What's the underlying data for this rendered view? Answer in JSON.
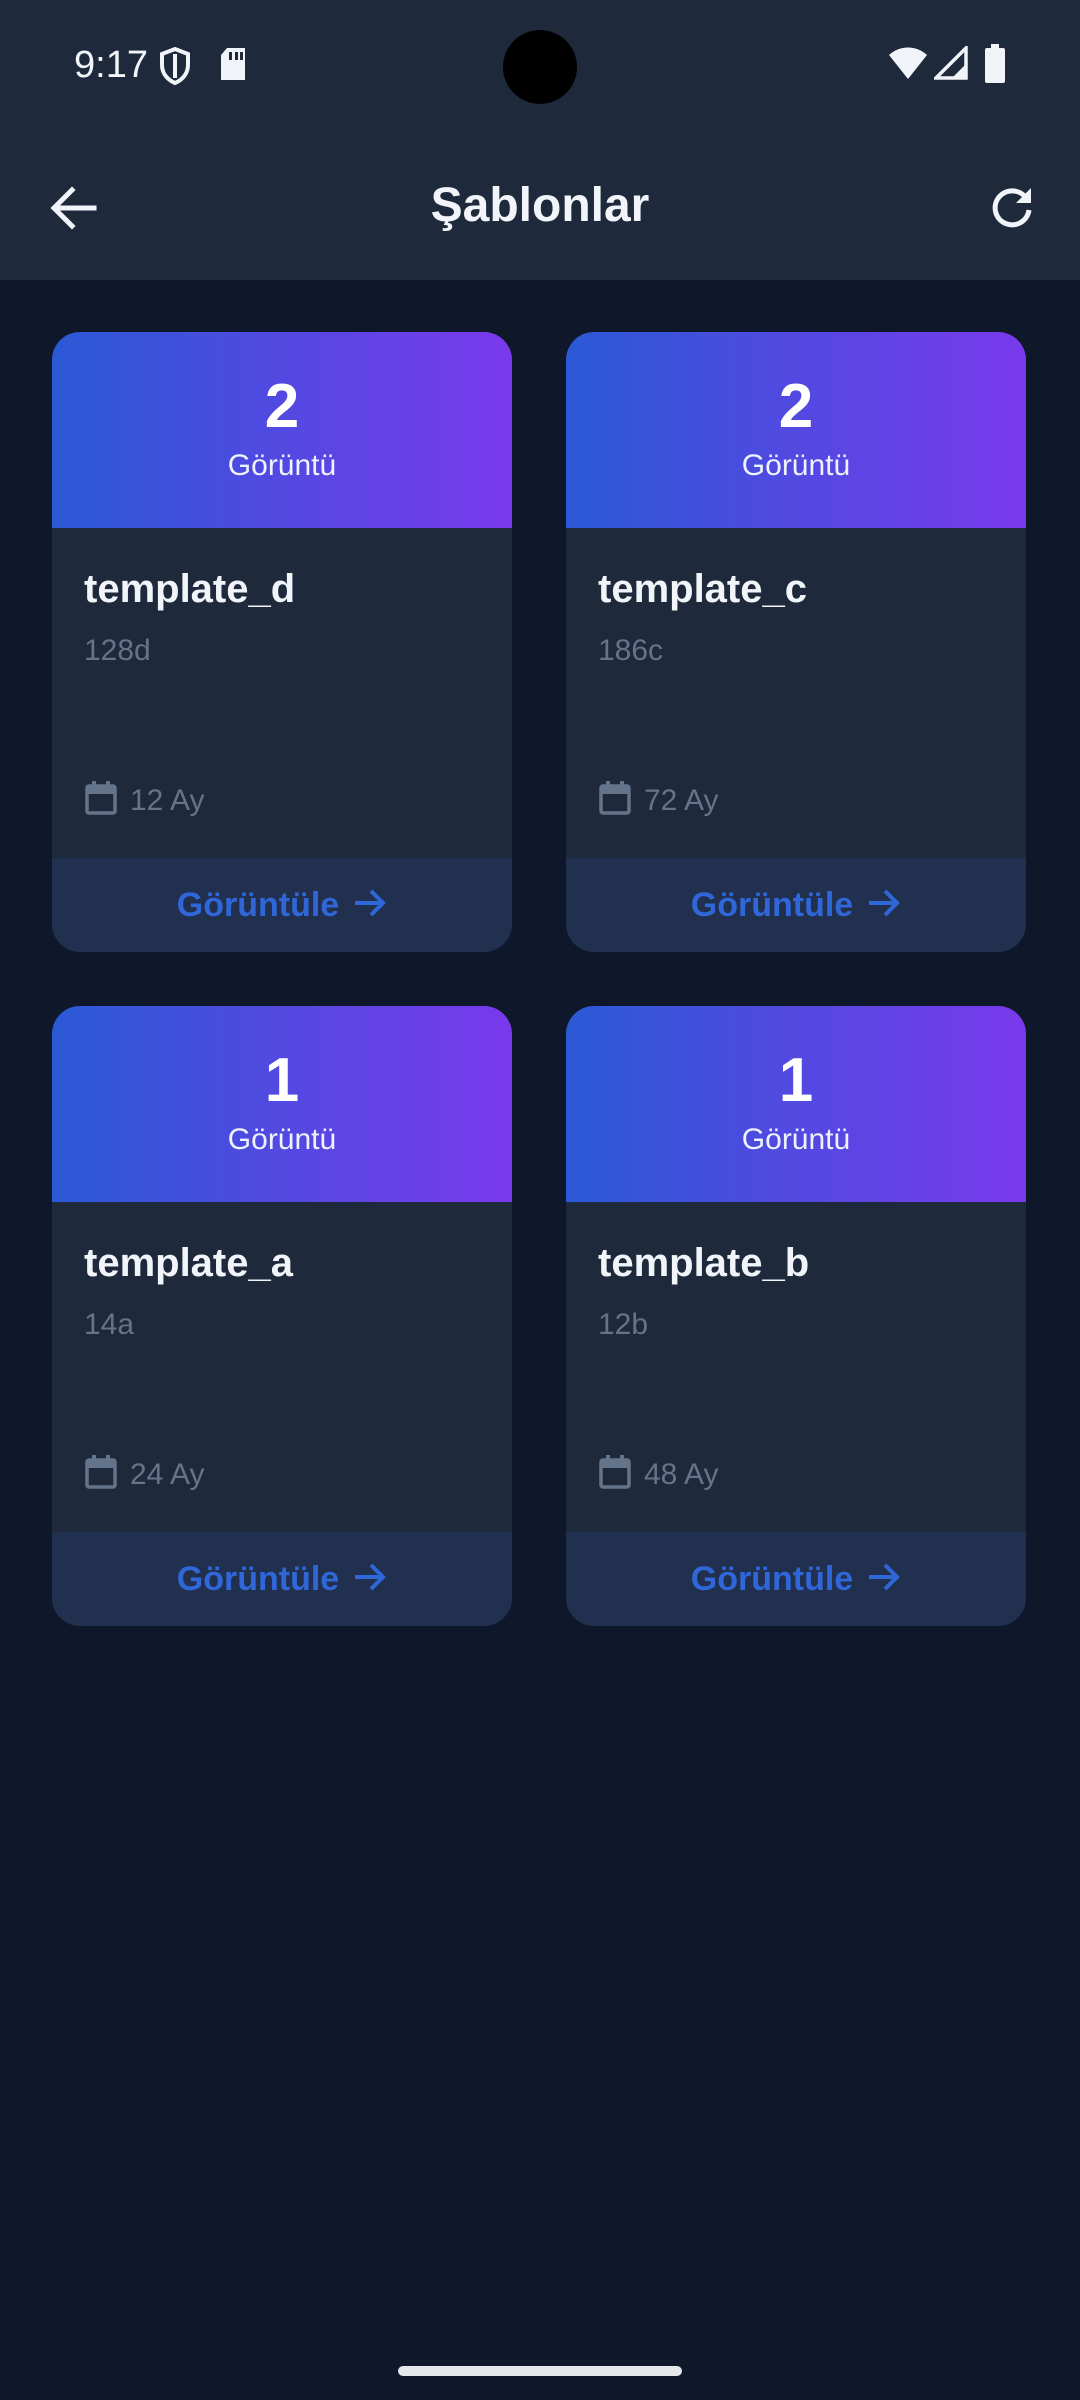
{
  "status_bar": {
    "time": "9:17"
  },
  "app_bar": {
    "title": "Şablonlar",
    "back_icon": "arrow-left-icon",
    "refresh_icon": "refresh-icon"
  },
  "colors": {
    "background": "#0f172a",
    "surface": "#1e293b",
    "gradient_start": "#2b59d6",
    "gradient_end": "#7a39ec",
    "accent": "#2f67d8"
  },
  "templates": [
    {
      "count": "2",
      "count_label": "Görüntü",
      "name": "template_d",
      "code": "128d",
      "period": "12 Ay",
      "action_label": "Görüntüle"
    },
    {
      "count": "2",
      "count_label": "Görüntü",
      "name": "template_c",
      "code": "186c",
      "period": "72 Ay",
      "action_label": "Görüntüle"
    },
    {
      "count": "1",
      "count_label": "Görüntü",
      "name": "template_a",
      "code": "14a",
      "period": "24 Ay",
      "action_label": "Görüntüle"
    },
    {
      "count": "1",
      "count_label": "Görüntü",
      "name": "template_b",
      "code": "12b",
      "period": "48 Ay",
      "action_label": "Görüntüle"
    }
  ]
}
